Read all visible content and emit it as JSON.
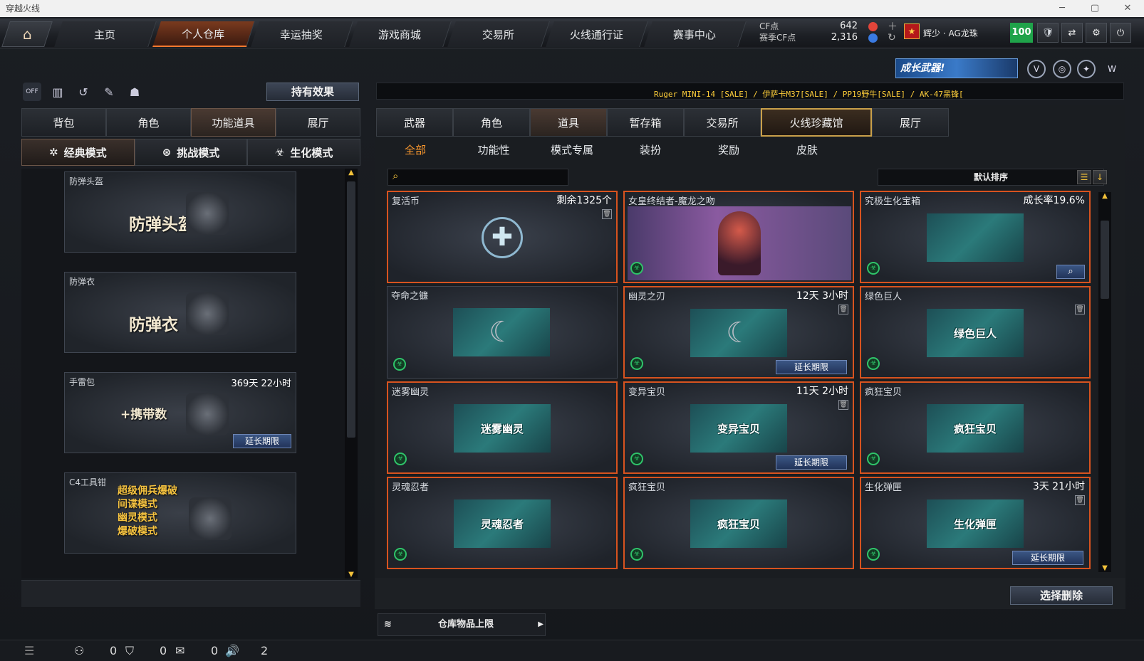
{
  "window": {
    "title": "穿越火线"
  },
  "topnav": {
    "tabs": [
      "主页",
      "个人仓库",
      "幸运抽奖",
      "游戏商城",
      "交易所",
      "火线通行证",
      "赛事中心"
    ],
    "active_index": 1
  },
  "currency": {
    "cf_label": "CF点",
    "event_cf_label": "赛季CF点",
    "cf_value": "642",
    "event_cf_value": "2,316"
  },
  "player": {
    "name": "辉少 · AG龙珠",
    "level": "100"
  },
  "left": {
    "effect_button": "持有效果",
    "tabs": [
      "背包",
      "角色",
      "功能道具",
      "展厅"
    ],
    "active_tab": 2,
    "modes": [
      "经典模式",
      "挑战模式",
      "生化模式"
    ],
    "active_mode": 0,
    "items": [
      {
        "name": "防弹头盔",
        "big": "防弹头盔",
        "time": "",
        "extend": ""
      },
      {
        "name": "防弹衣",
        "big": "防弹衣",
        "time": "",
        "extend": ""
      },
      {
        "name": "手雷包",
        "big": "+携带数",
        "time": "369天 22小时",
        "extend": "延长期限"
      },
      {
        "name": "C4工具钳",
        "big": "超级佣兵爆破\n间谍模式\n幽灵模式\n爆破模式",
        "time": "",
        "extend": ""
      }
    ]
  },
  "right": {
    "promo": "成长武器!",
    "ticker": "Ruger MINI-14  [SALE] / 伊萨卡M37[SALE] / PP19野牛[SALE] / AK-47黑锋[",
    "tabs": [
      "武器",
      "角色",
      "道具",
      "暂存箱",
      "交易所",
      "火线珍藏馆",
      "展厅"
    ],
    "active_tab": 2,
    "gold_tab": 5,
    "subtabs": [
      "全部",
      "功能性",
      "模式专属",
      "装扮",
      "奖励",
      "皮肤"
    ],
    "active_subtab": 0,
    "search_placeholder": "",
    "sort_label": "默认排序",
    "items": [
      {
        "name": "复活币",
        "meta": "剩余1325个",
        "cap": "",
        "extend": "",
        "trash": true,
        "badge": false
      },
      {
        "name": "女皇终结者-魔龙之吻",
        "meta": "",
        "cap": "",
        "extend": "",
        "trash": false,
        "badge": true
      },
      {
        "name": "究极生化宝箱",
        "meta": "成长率19.6%",
        "cap": "",
        "extend": "",
        "trash": false,
        "badge": true,
        "magnify": true
      },
      {
        "name": "夺命之镰",
        "meta": "",
        "cap": "",
        "extend": "",
        "trash": false,
        "badge": true
      },
      {
        "name": "幽灵之刃",
        "meta": "12天 3小时",
        "cap": "",
        "extend": "延长期限",
        "trash": true,
        "badge": true
      },
      {
        "name": "绿色巨人",
        "meta": "",
        "cap": "绿色巨人",
        "extend": "",
        "trash": true,
        "badge": true
      },
      {
        "name": "迷雾幽灵",
        "meta": "",
        "cap": "迷雾幽灵",
        "extend": "",
        "trash": false,
        "badge": true
      },
      {
        "name": "变异宝贝",
        "meta": "11天 2小时",
        "cap": "变异宝贝",
        "extend": "延长期限",
        "trash": true,
        "badge": true
      },
      {
        "name": "疯狂宝贝",
        "meta": "",
        "cap": "疯狂宝贝",
        "extend": "",
        "trash": false,
        "badge": true
      },
      {
        "name": "灵魂忍者",
        "meta": "",
        "cap": "灵魂忍者",
        "extend": "",
        "trash": false,
        "badge": true
      },
      {
        "name": "疯狂宝贝",
        "meta": "",
        "cap": "疯狂宝贝",
        "extend": "",
        "trash": false,
        "badge": true
      },
      {
        "name": "生化弹匣",
        "meta": "3天 21小时",
        "cap": "生化弹匣",
        "extend": "延长期限",
        "trash": true,
        "badge": true
      }
    ],
    "delete_button": "选择删除",
    "capacity_label": "仓库物品上限"
  },
  "bottom": {
    "c1": "0",
    "c2": "0",
    "c3": "0",
    "c4": "2"
  }
}
